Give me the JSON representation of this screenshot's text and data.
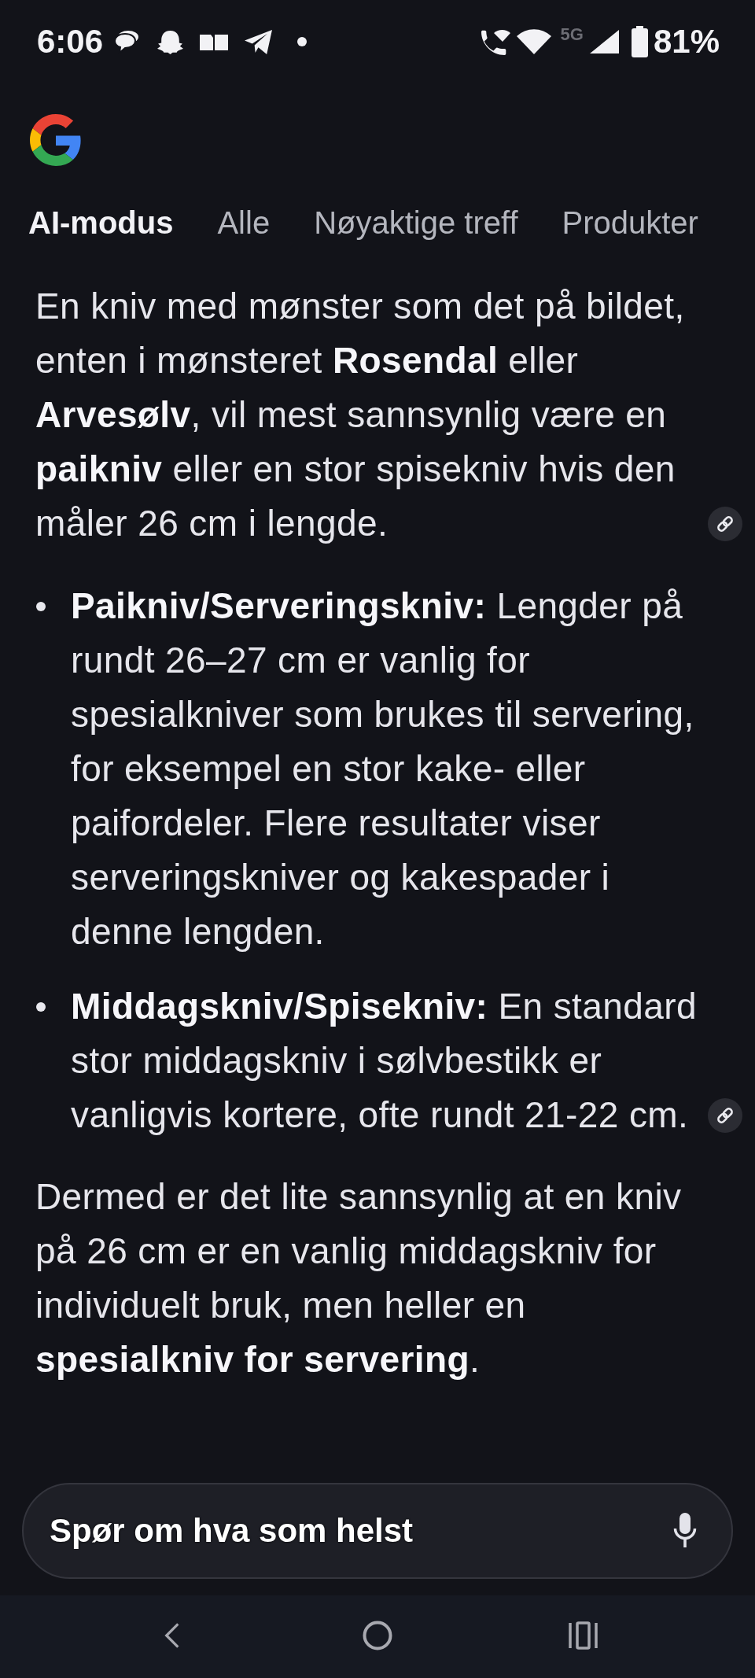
{
  "status_bar": {
    "time": "6:06",
    "network": "5G",
    "battery": "81%"
  },
  "tabs": [
    {
      "label": "AI-modus",
      "selected": true
    },
    {
      "label": "Alle",
      "selected": false
    },
    {
      "label": "Nøyaktige treff",
      "selected": false
    },
    {
      "label": "Produkter",
      "selected": false
    }
  ],
  "answer": [
    {
      "kind": "paragraph",
      "text": "En kniv med mønster som det på bildet, enten i mønsteret **Rosendal** eller **Arvesølv**, vil mest sannsynlig være en **paikniv** eller en stor spisekniv hvis den måler 26 cm i lengde.",
      "source_link": true
    },
    {
      "kind": "bullet",
      "text": "**Paikniv/Serveringskniv:** Lengder på rundt 26–27 cm er vanlig for spesialkniver som brukes til servering, for eksempel en stor kake- eller paifordeler. Flere resultater viser serveringskniver og kakespader i denne lengden.",
      "source_link": false
    },
    {
      "kind": "bullet",
      "text": "**Middagskniv/Spisekniv:** En standard stor middagskniv i sølvbestikk er vanligvis kortere, ofte rundt 21-22 cm.",
      "source_link": true
    },
    {
      "kind": "paragraph",
      "text": "Dermed er det lite sannsynlig at en kniv på 26 cm er en vanlig middagskniv for individuelt bruk, men heller en **spesialkniv for servering**.",
      "source_link": false
    }
  ],
  "search": {
    "placeholder": "Spør om hva som helst"
  }
}
